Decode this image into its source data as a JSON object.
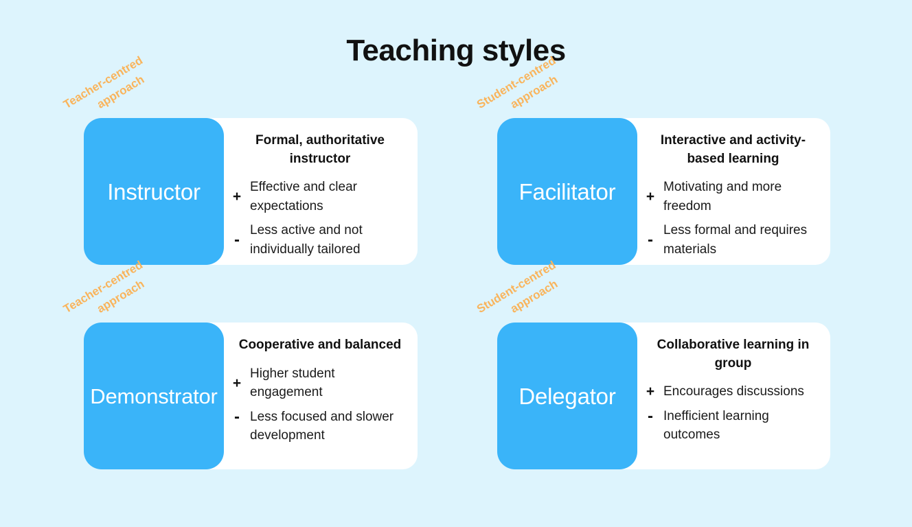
{
  "title": "Teaching styles",
  "colors": {
    "background": "#ddf4fd",
    "tile_blue": "#3ab4f9",
    "panel_white": "#ffffff",
    "tag_orange": "#f9b45c",
    "text_dark": "#111111"
  },
  "approach_labels": {
    "teacher": {
      "line1": "Teacher-centred",
      "line2": "approach"
    },
    "student": {
      "line1": "Student-centred",
      "line2": "approach"
    }
  },
  "cards": [
    {
      "name": "Instructor",
      "approach": "Teacher-centred approach",
      "heading": "Formal, authoritative instructor",
      "pro_sign": "+",
      "pro": "Effective and clear expectations",
      "con_sign": "-",
      "con": "Less active and not individually tailored"
    },
    {
      "name": "Facilitator",
      "approach": "Student-centred approach",
      "heading": "Interactive and activity-based learning",
      "pro_sign": "+",
      "pro": "Motivating and more freedom",
      "con_sign": "-",
      "con": "Less formal and requires materials"
    },
    {
      "name": "Demonstrator",
      "approach": "Teacher-centred approach",
      "heading": "Cooperative and balanced",
      "pro_sign": "+",
      "pro": "Higher student engagement",
      "con_sign": "-",
      "con": "Less focused and slower development"
    },
    {
      "name": "Delegator",
      "approach": "Student-centred approach",
      "heading": "Collaborative learning in group",
      "pro_sign": "+",
      "pro": "Encourages discussions",
      "con_sign": "-",
      "con": "Inefficient learning outcomes"
    }
  ]
}
